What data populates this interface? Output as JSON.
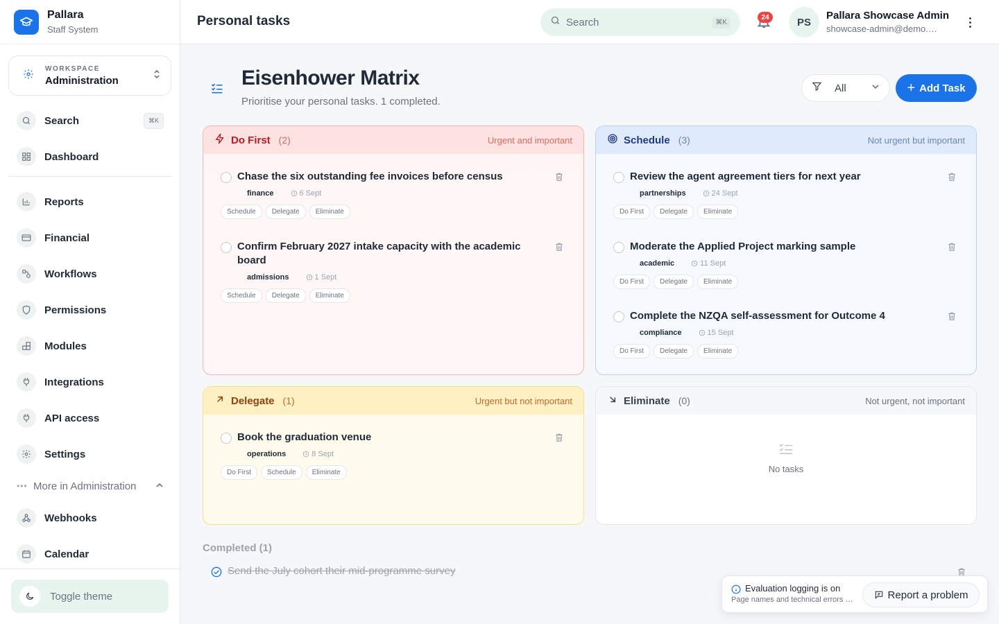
{
  "brand": {
    "name": "Pallara",
    "subtitle": "Staff System"
  },
  "workspace": {
    "label": "WORKSPACE",
    "name": "Administration"
  },
  "sidebar": {
    "search_label": "Search",
    "search_shortcut": "⌘K",
    "dashboard_label": "Dashboard",
    "items": [
      {
        "label": "Reports",
        "icon": "bar-chart-icon"
      },
      {
        "label": "Financial",
        "icon": "credit-card-icon"
      },
      {
        "label": "Workflows",
        "icon": "workflow-icon"
      },
      {
        "label": "Permissions",
        "icon": "shield-icon"
      },
      {
        "label": "Modules",
        "icon": "modules-icon"
      },
      {
        "label": "Integrations",
        "icon": "plug-icon"
      },
      {
        "label": "API access",
        "icon": "plug-icon"
      },
      {
        "label": "Settings",
        "icon": "gear-icon"
      }
    ],
    "more_label": "More in Administration",
    "more_items": [
      {
        "label": "Webhooks",
        "icon": "webhook-icon"
      },
      {
        "label": "Calendar",
        "icon": "calendar-icon"
      }
    ],
    "toggle_theme": "Toggle theme"
  },
  "topbar": {
    "title": "Personal tasks",
    "search_placeholder": "Search",
    "search_shortcut": "⌘K",
    "notification_count": "24",
    "user_initials": "PS",
    "user_name": "Pallara Showcase Admin",
    "user_email": "showcase-admin@demo.pallara.nz"
  },
  "header": {
    "title": "Eisenhower Matrix",
    "subtitle": "Prioritise your personal tasks. 1 completed.",
    "filter_value": "All",
    "add_task_label": "Add Task"
  },
  "quadrants": {
    "do_first": {
      "title": "Do First",
      "count": "(2)",
      "description": "Urgent and important",
      "tasks": [
        {
          "title": "Chase the six outstanding fee invoices before census",
          "tag": "finance",
          "date": "6 Sept",
          "actions": [
            "Schedule",
            "Delegate",
            "Eliminate"
          ]
        },
        {
          "title": "Confirm February 2027 intake capacity with the academic board",
          "tag": "admissions",
          "date": "1 Sept",
          "actions": [
            "Schedule",
            "Delegate",
            "Eliminate"
          ]
        }
      ]
    },
    "schedule": {
      "title": "Schedule",
      "count": "(3)",
      "description": "Not urgent but important",
      "tasks": [
        {
          "title": "Review the agent agreement tiers for next year",
          "tag": "partnerships",
          "date": "24 Sept",
          "actions": [
            "Do First",
            "Delegate",
            "Eliminate"
          ]
        },
        {
          "title": "Moderate the Applied Project marking sample",
          "tag": "academic",
          "date": "11 Sept",
          "actions": [
            "Do First",
            "Delegate",
            "Eliminate"
          ]
        },
        {
          "title": "Complete the NZQA self-assessment for Outcome 4",
          "tag": "compliance",
          "date": "15 Sept",
          "actions": [
            "Do First",
            "Delegate",
            "Eliminate"
          ]
        }
      ]
    },
    "delegate": {
      "title": "Delegate",
      "count": "(1)",
      "description": "Urgent but not important",
      "tasks": [
        {
          "title": "Book the graduation venue",
          "tag": "operations",
          "date": "8 Sept",
          "actions": [
            "Do First",
            "Schedule",
            "Eliminate"
          ]
        }
      ]
    },
    "eliminate": {
      "title": "Eliminate",
      "count": "(0)",
      "description": "Not urgent, not important",
      "empty_label": "No tasks"
    }
  },
  "completed": {
    "title": "Completed (1)",
    "tasks": [
      {
        "title": "Send the July cohort their mid-programme survey"
      }
    ]
  },
  "toast": {
    "title": "Evaluation logging is on",
    "subtitle": "Page names and technical errors are recorded",
    "report_label": "Report a problem"
  },
  "colors": {
    "accent": "#1a73e8",
    "do_first": "#b91c1c",
    "schedule": "#1e3a8a",
    "delegate": "#92400e",
    "badge": "#ef4444"
  }
}
